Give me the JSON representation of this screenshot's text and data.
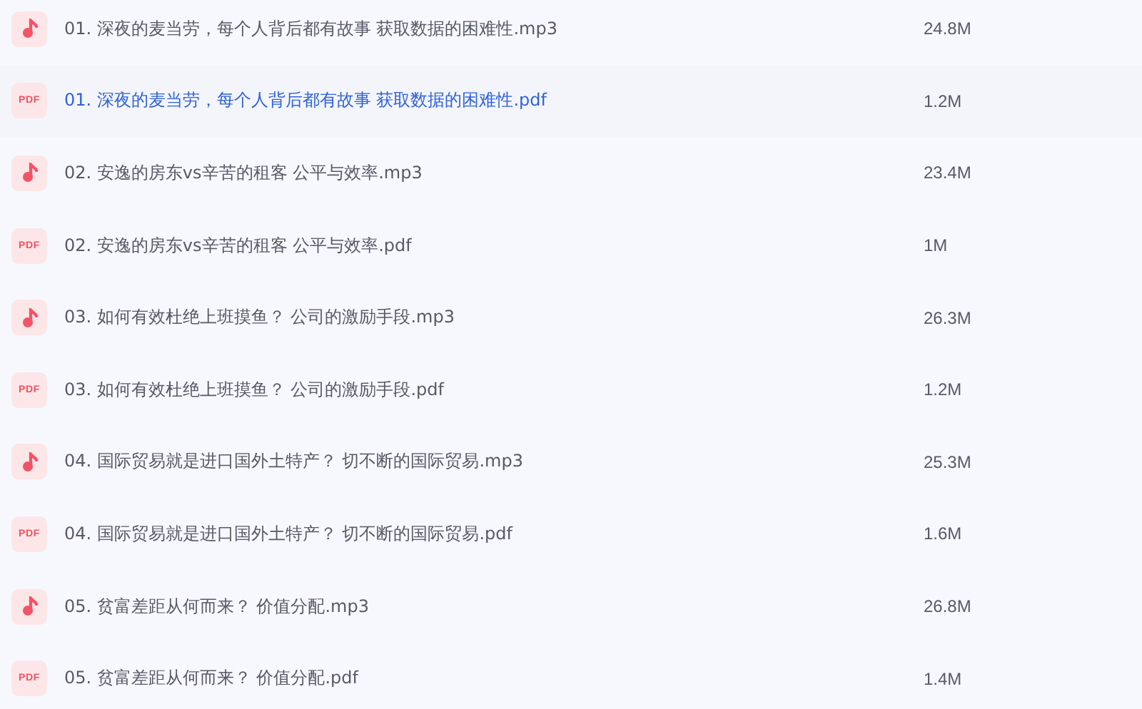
{
  "files": [
    {
      "kind": "audio",
      "name": "01. 深夜的麦当劳，每个人背后都有故事 获取数据的困难性.mp3",
      "size": "24.8M",
      "selected": false
    },
    {
      "kind": "pdf",
      "icon_text": "PDF",
      "name": "01. 深夜的麦当劳，每个人背后都有故事 获取数据的困难性.pdf",
      "size": "1.2M",
      "selected": true
    },
    {
      "kind": "audio",
      "name": "02. 安逸的房东vs辛苦的租客 公平与效率.mp3",
      "size": "23.4M",
      "selected": false
    },
    {
      "kind": "pdf",
      "icon_text": "PDF",
      "name": "02. 安逸的房东vs辛苦的租客 公平与效率.pdf",
      "size": "1M",
      "selected": false
    },
    {
      "kind": "audio",
      "name": "03. 如何有效杜绝上班摸鱼？ 公司的激励手段.mp3",
      "size": "26.3M",
      "selected": false
    },
    {
      "kind": "pdf",
      "icon_text": "PDF",
      "name": "03. 如何有效杜绝上班摸鱼？ 公司的激励手段.pdf",
      "size": "1.2M",
      "selected": false
    },
    {
      "kind": "audio",
      "name": "04. 国际贸易就是进口国外土特产？ 切不断的国际贸易.mp3",
      "size": "25.3M",
      "selected": false
    },
    {
      "kind": "pdf",
      "icon_text": "PDF",
      "name": "04. 国际贸易就是进口国外土特产？ 切不断的国际贸易.pdf",
      "size": "1.6M",
      "selected": false
    },
    {
      "kind": "audio",
      "name": "05. 贫富差距从何而来？ 价值分配.mp3",
      "size": "26.8M",
      "selected": false
    },
    {
      "kind": "pdf",
      "icon_text": "PDF",
      "name": "05. 贫富差距从何而来？ 价值分配.pdf",
      "size": "1.4M",
      "selected": false
    }
  ]
}
